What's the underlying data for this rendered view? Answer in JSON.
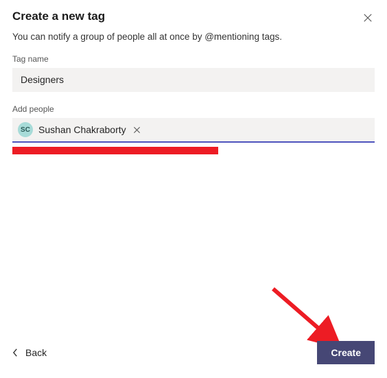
{
  "dialog": {
    "title": "Create a new tag",
    "subtitle": "You can notify a group of people all at once by @mentioning tags."
  },
  "fields": {
    "tag_name_label": "Tag name",
    "tag_name_value": "Designers",
    "add_people_label": "Add people",
    "people": [
      {
        "initials": "SC",
        "name": "Sushan Chakraborty"
      }
    ]
  },
  "footer": {
    "back_label": "Back",
    "create_label": "Create"
  },
  "annotation": {
    "redbar_color": "#ed1c24",
    "arrow_color": "#ed1c24"
  }
}
